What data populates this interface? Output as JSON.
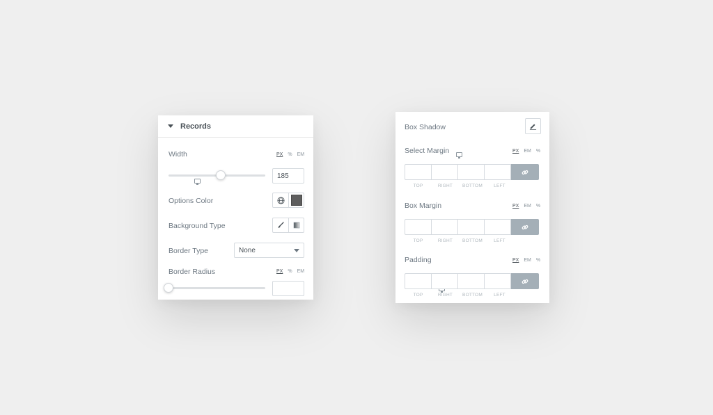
{
  "left_panel": {
    "section_title": "Records",
    "width_label": "Width",
    "units": [
      "PX",
      "%",
      "EM"
    ],
    "width_value": "185",
    "width_slider_fraction": 0.54,
    "options_color_label": "Options Color",
    "options_color_swatch": "#5e5e5e",
    "background_type_label": "Background Type",
    "border_type_label": "Border Type",
    "border_type_value": "None",
    "border_radius_label": "Border Radius",
    "border_radius_value": "",
    "border_radius_slider_fraction": 0.0
  },
  "right_panel": {
    "box_shadow_label": "Box Shadow",
    "units": [
      "PX",
      "EM",
      "%"
    ],
    "sides": [
      "TOP",
      "RIGHT",
      "BOTTOM",
      "LEFT"
    ],
    "groups": [
      {
        "label": "Select Margin"
      },
      {
        "label": "Box Margin"
      },
      {
        "label": "Padding"
      }
    ]
  },
  "colors": {
    "link_button": "#a4afb7",
    "background": "#efefef"
  }
}
